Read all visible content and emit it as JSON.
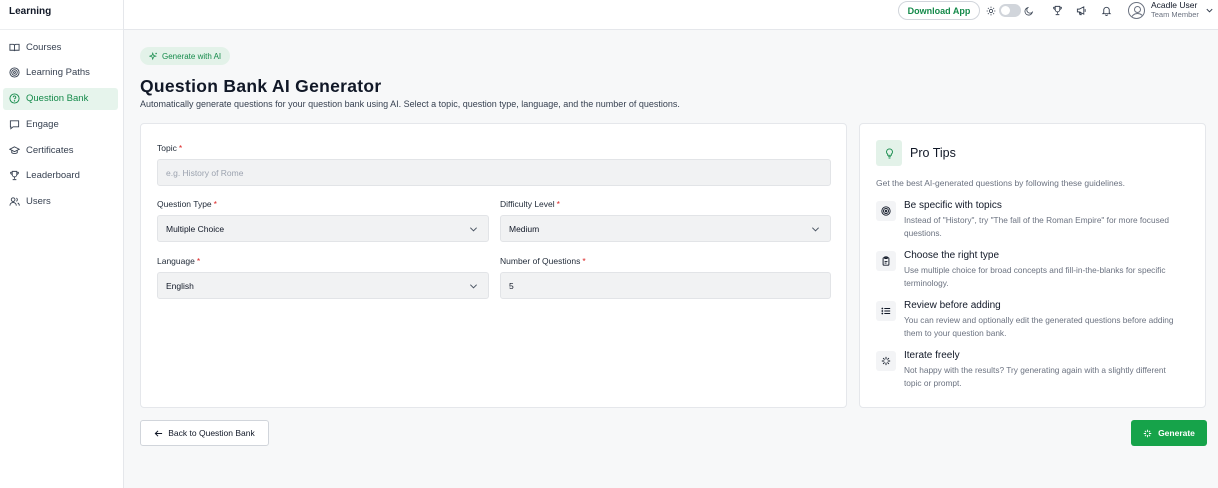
{
  "sidebar": {
    "brand": "Learning",
    "items": [
      {
        "label": "Courses",
        "icon": "book-icon"
      },
      {
        "label": "Learning Paths",
        "icon": "target-icon"
      },
      {
        "label": "Question Bank",
        "icon": "question-circle-icon",
        "active": true
      },
      {
        "label": "Engage",
        "icon": "chat-icon"
      },
      {
        "label": "Certificates",
        "icon": "graduation-cap-icon"
      },
      {
        "label": "Leaderboard",
        "icon": "trophy-icon"
      },
      {
        "label": "Users",
        "icon": "users-icon"
      }
    ]
  },
  "header": {
    "download_label": "Download App",
    "user_name": "Acadle User",
    "user_role": "Team Member"
  },
  "page": {
    "badge": "Generate with AI",
    "title": "Question Bank AI Generator",
    "subtitle": "Automatically generate questions for your question bank using AI. Select a topic, question type, language, and the number of questions."
  },
  "form": {
    "topic_label": "Topic",
    "topic_placeholder": "e.g. History of Rome",
    "question_type_label": "Question Type",
    "question_type_value": "Multiple Choice",
    "difficulty_label": "Difficulty Level",
    "difficulty_value": "Medium",
    "language_label": "Language",
    "language_value": "English",
    "count_label": "Number of Questions",
    "count_value": "5",
    "required_mark": "*"
  },
  "tips": {
    "title": "Pro Tips",
    "intro": "Get the best AI-generated questions by following these guidelines.",
    "items": [
      {
        "title": "Be specific with topics",
        "desc": "Instead of \"History\", try \"The fall of the Roman Empire\" for more focused questions."
      },
      {
        "title": "Choose the right type",
        "desc": "Use multiple choice for broad concepts and fill-in-the-blanks for specific terminology."
      },
      {
        "title": "Review before adding",
        "desc": "You can review and optionally edit the generated questions before adding them to your question bank."
      },
      {
        "title": "Iterate freely",
        "desc": "Not happy with the results? Try generating again with a slightly different topic or prompt."
      }
    ]
  },
  "actions": {
    "back_label": "Back to Question Bank",
    "generate_label": "Generate"
  },
  "colors": {
    "accent": "#16a34a",
    "accent_text": "#148a4a",
    "accent_bg": "#e6f4ec",
    "required": "#dc2626"
  }
}
